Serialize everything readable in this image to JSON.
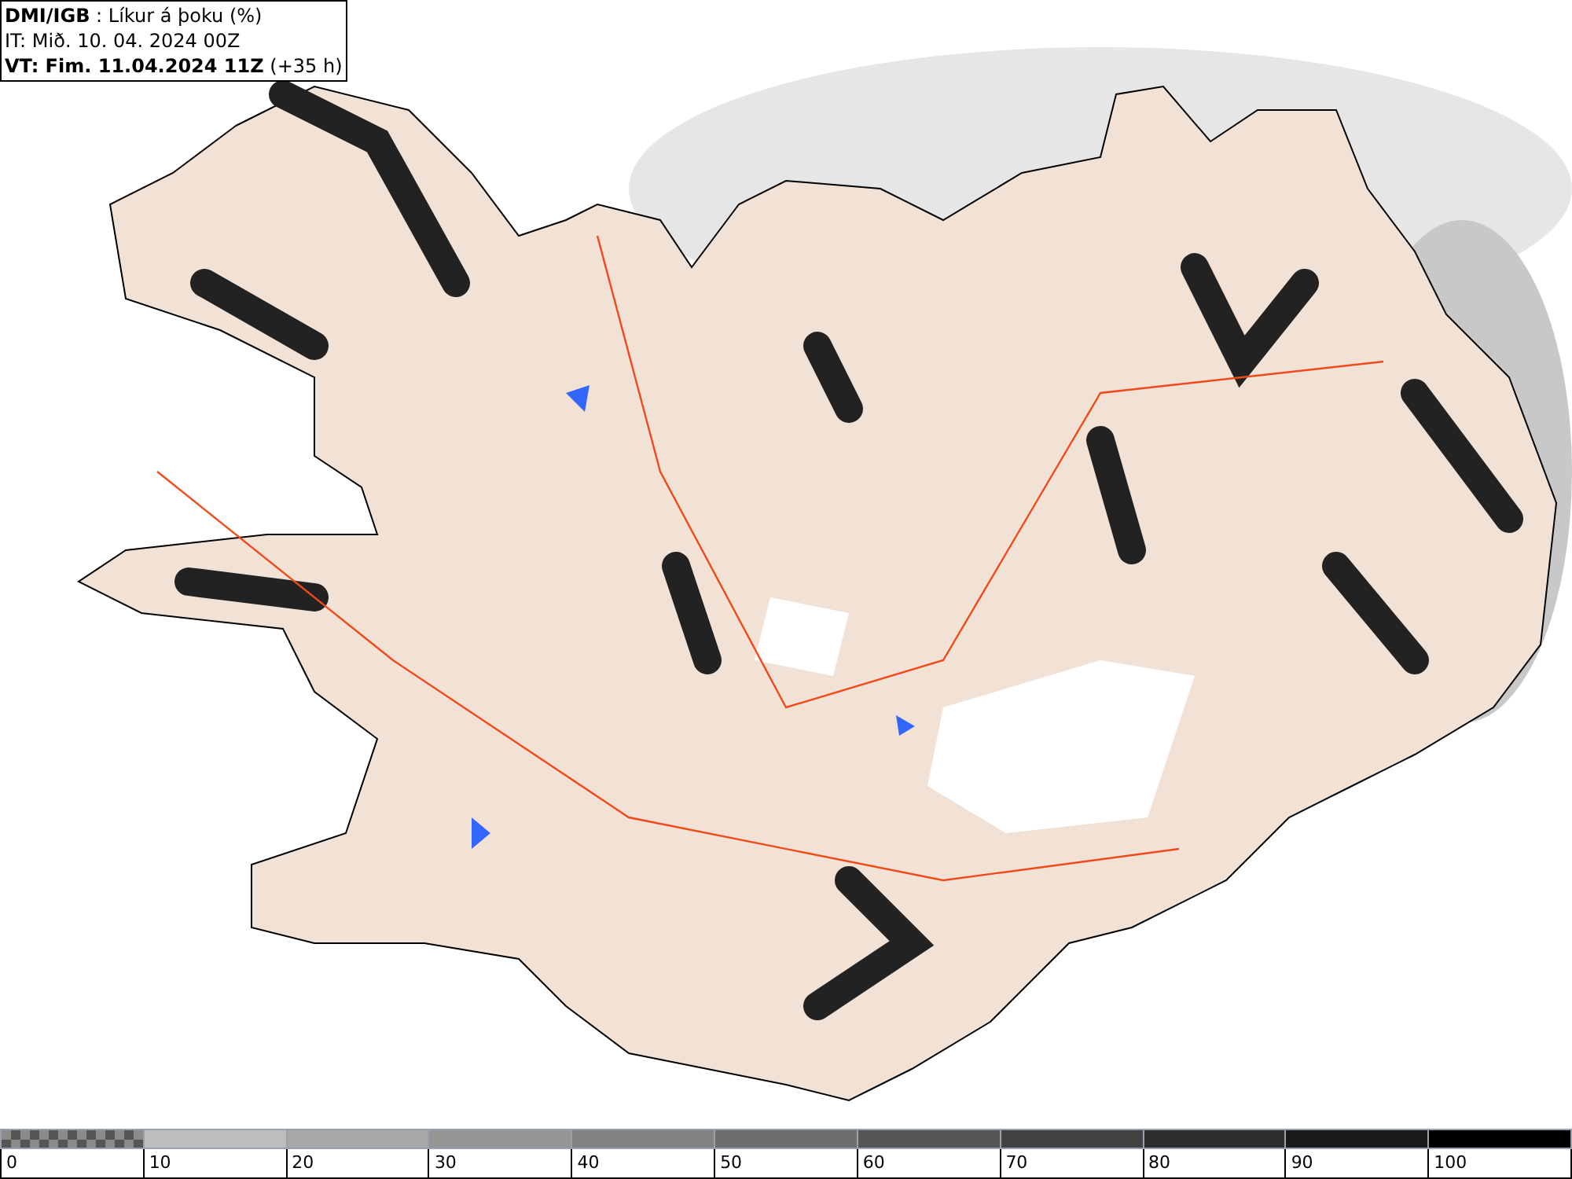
{
  "header": {
    "lines": [
      "**DMI/IGB** : Líkur á þoku (%)",
      "IT: Mið. 10. 04. 2024 00Z",
      "**VT: Fim. 11.04.2024 11Z** (+35 h)"
    ]
  },
  "legend": {
    "bins": [
      {
        "kind": "checker",
        "color": "#8a8a8a"
      },
      {
        "kind": "solid",
        "color": "#bdbdbd"
      },
      {
        "kind": "solid",
        "color": "#a8a8a8"
      },
      {
        "kind": "solid",
        "color": "#969696"
      },
      {
        "kind": "solid",
        "color": "#828282"
      },
      {
        "kind": "solid",
        "color": "#6e6e6e"
      },
      {
        "kind": "solid",
        "color": "#565656"
      },
      {
        "kind": "solid",
        "color": "#424242"
      },
      {
        "kind": "solid",
        "color": "#2e2e2e"
      },
      {
        "kind": "solid",
        "color": "#1a1a1a"
      },
      {
        "kind": "solid",
        "color": "#000000"
      }
    ],
    "ticks": [
      "0",
      "10",
      "20",
      "30",
      "40",
      "50",
      "60",
      "70",
      "80",
      "90",
      "100"
    ]
  }
}
